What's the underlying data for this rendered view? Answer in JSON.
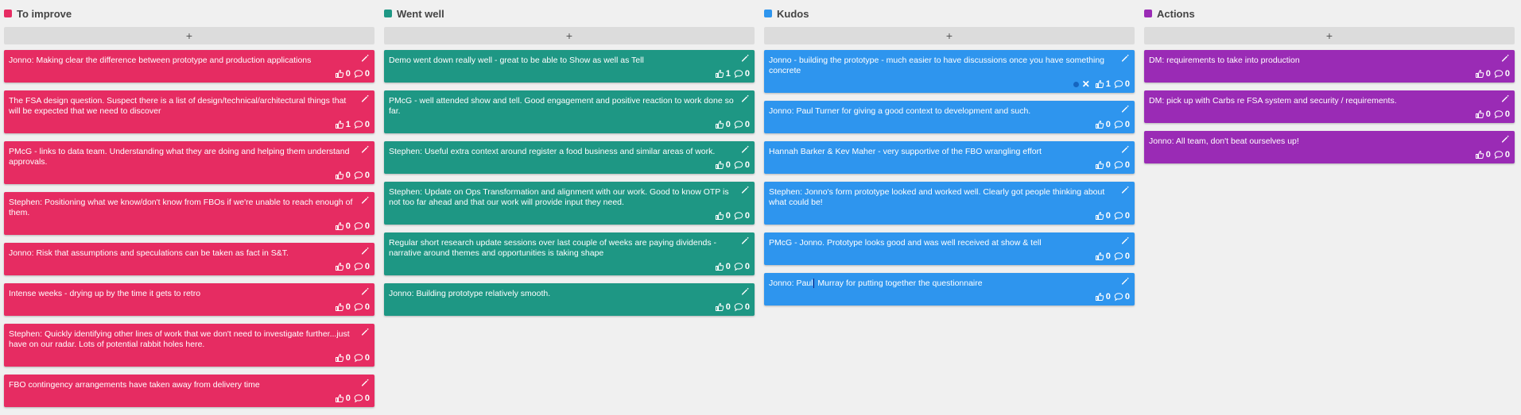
{
  "colors": {
    "improve": "#e62c62",
    "went_well": "#1e9784",
    "kudos": "#2e95ee",
    "actions": "#9a2bb5"
  },
  "add_label": "+",
  "icons": {
    "edit": "pencil-icon",
    "vote": "thumbs-up-icon",
    "comment": "comment-icon"
  },
  "columns": [
    {
      "key": "improve",
      "title": "To improve",
      "cards": [
        {
          "text": "Jonno: Making clear the difference between prototype and production applications",
          "votes": "0",
          "comments": "0"
        },
        {
          "text": "The FSA design question. Suspect there is a list of design/technical/architectural things that will be expected that we need to discover",
          "votes": "1",
          "comments": "0"
        },
        {
          "text": "PMcG - links to data team. Understanding what they are doing and helping them understand approvals.",
          "votes": "0",
          "comments": "0"
        },
        {
          "text": "Stephen: Positioning what we know/don't know from FBOs if we're unable to reach enough of them.",
          "votes": "0",
          "comments": "0"
        },
        {
          "text": "Jonno: Risk that assumptions and speculations can be taken as fact in S&T.",
          "votes": "0",
          "comments": "0"
        },
        {
          "text": "Intense weeks - drying up by the time it gets to retro",
          "votes": "0",
          "comments": "0"
        },
        {
          "text": "Stephen: Quickly identifying other lines of work that we don't need to investigate further...just have on our radar. Lots of potential rabbit holes here.",
          "votes": "0",
          "comments": "0"
        },
        {
          "text": "FBO contingency arrangements have taken away from delivery time",
          "votes": "0",
          "comments": "0"
        }
      ]
    },
    {
      "key": "went_well",
      "title": "Went well",
      "cards": [
        {
          "text": "Demo went down really well - great to be able to Show as well as Tell",
          "votes": "1",
          "comments": "0"
        },
        {
          "text": "PMcG - well attended show and tell. Good engagement and positive reaction to work done so far.",
          "votes": "0",
          "comments": "0"
        },
        {
          "text": "Stephen: Useful extra context around register a food business and similar areas of work.",
          "votes": "0",
          "comments": "0"
        },
        {
          "text": "Stephen: Update on Ops Transformation and alignment with our work. Good to know OTP is not too far ahead and that our work will provide input they need.",
          "votes": "0",
          "comments": "0"
        },
        {
          "text": "Regular short research update sessions over last couple of weeks are paying dividends - narrative around themes and opportunities is taking shape",
          "votes": "0",
          "comments": "0"
        },
        {
          "text": "Jonno: Building prototype relatively smooth.",
          "votes": "0",
          "comments": "0"
        }
      ]
    },
    {
      "key": "kudos",
      "title": "Kudos",
      "cards": [
        {
          "text": "Jonno - building the prototype - much easier to have discussions once you have something concrete",
          "votes": "1",
          "comments": "0",
          "own": true
        },
        {
          "text": "Jonno: Paul Turner for giving a good context to development and such.",
          "votes": "0",
          "comments": "0"
        },
        {
          "text": "Hannah Barker & Kev Maher - very supportive of the FBO wrangling effort",
          "votes": "0",
          "comments": "0"
        },
        {
          "text": "Stephen: Jonno's form prototype looked and worked well. Clearly got people thinking about what could be!",
          "votes": "0",
          "comments": "0"
        },
        {
          "text": "PMcG - Jonno. Prototype looks good and was well received at show & tell",
          "votes": "0",
          "comments": "0"
        },
        {
          "text": "Jonno: Paul Murray for putting together the questionnaire",
          "votes": "0",
          "comments": "0",
          "caret_after": "Jonno: Paul",
          "caret_rest": " Murray for putting together the questionnaire"
        }
      ]
    },
    {
      "key": "actions",
      "title": "Actions",
      "cards": [
        {
          "text": "DM: requirements to take into production",
          "votes": "0",
          "comments": "0"
        },
        {
          "text": "DM: pick up with Carbs re FSA system and security / requirements.",
          "votes": "0",
          "comments": "0"
        },
        {
          "text": "Jonno: All team, don't beat ourselves up!",
          "votes": "0",
          "comments": "0"
        }
      ]
    }
  ]
}
